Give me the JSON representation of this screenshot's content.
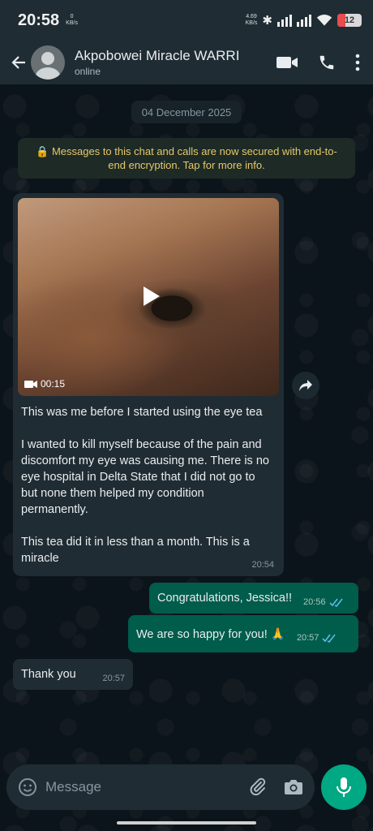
{
  "status_bar": {
    "time": "20:58",
    "net_left_value": "0",
    "net_left_unit": "KB/s",
    "net_right_value": "4.69",
    "net_right_unit": "KB/s",
    "battery": "12"
  },
  "header": {
    "contact_name": "Akpobowei Miracle WARRI",
    "contact_status": "online"
  },
  "chat": {
    "date": "04 December 2025",
    "encryption_notice": "Messages to this chat and calls are now secured with end-to-end encryption. Tap for more info.",
    "video_message": {
      "duration": "00:15",
      "caption_p1": "This was me before I started using the eye tea",
      "caption_p2": "I wanted to kill myself because of the pain and discomfort my eye was causing me. There is no eye hospital in Delta State that I did not go to but none them helped my condition permanently.",
      "caption_p3": "This tea did it in less than a month. This is a miracle",
      "time": "20:54"
    },
    "outgoing": [
      {
        "text": "Congratulations, Jessica!!",
        "time": "20:56"
      },
      {
        "text": "We are so happy for you! 🙏",
        "time": "20:57"
      }
    ],
    "incoming_last": {
      "text": "Thank you",
      "time": "20:57"
    }
  },
  "composer": {
    "placeholder": "Message"
  },
  "colors": {
    "header_bg": "#1f2c34",
    "chat_bg": "#0b141a",
    "incoming_bubble": "#202c33",
    "outgoing_bubble": "#005c4b",
    "accent": "#00a884",
    "read_ticks": "#53bdeb"
  },
  "icons": [
    "back-arrow-icon",
    "avatar-icon",
    "video-call-icon",
    "phone-icon",
    "more-icon",
    "lock-icon",
    "play-icon",
    "video-camera-icon",
    "forward-icon",
    "double-check-icon",
    "emoji-icon",
    "attach-icon",
    "camera-icon",
    "mic-icon"
  ]
}
